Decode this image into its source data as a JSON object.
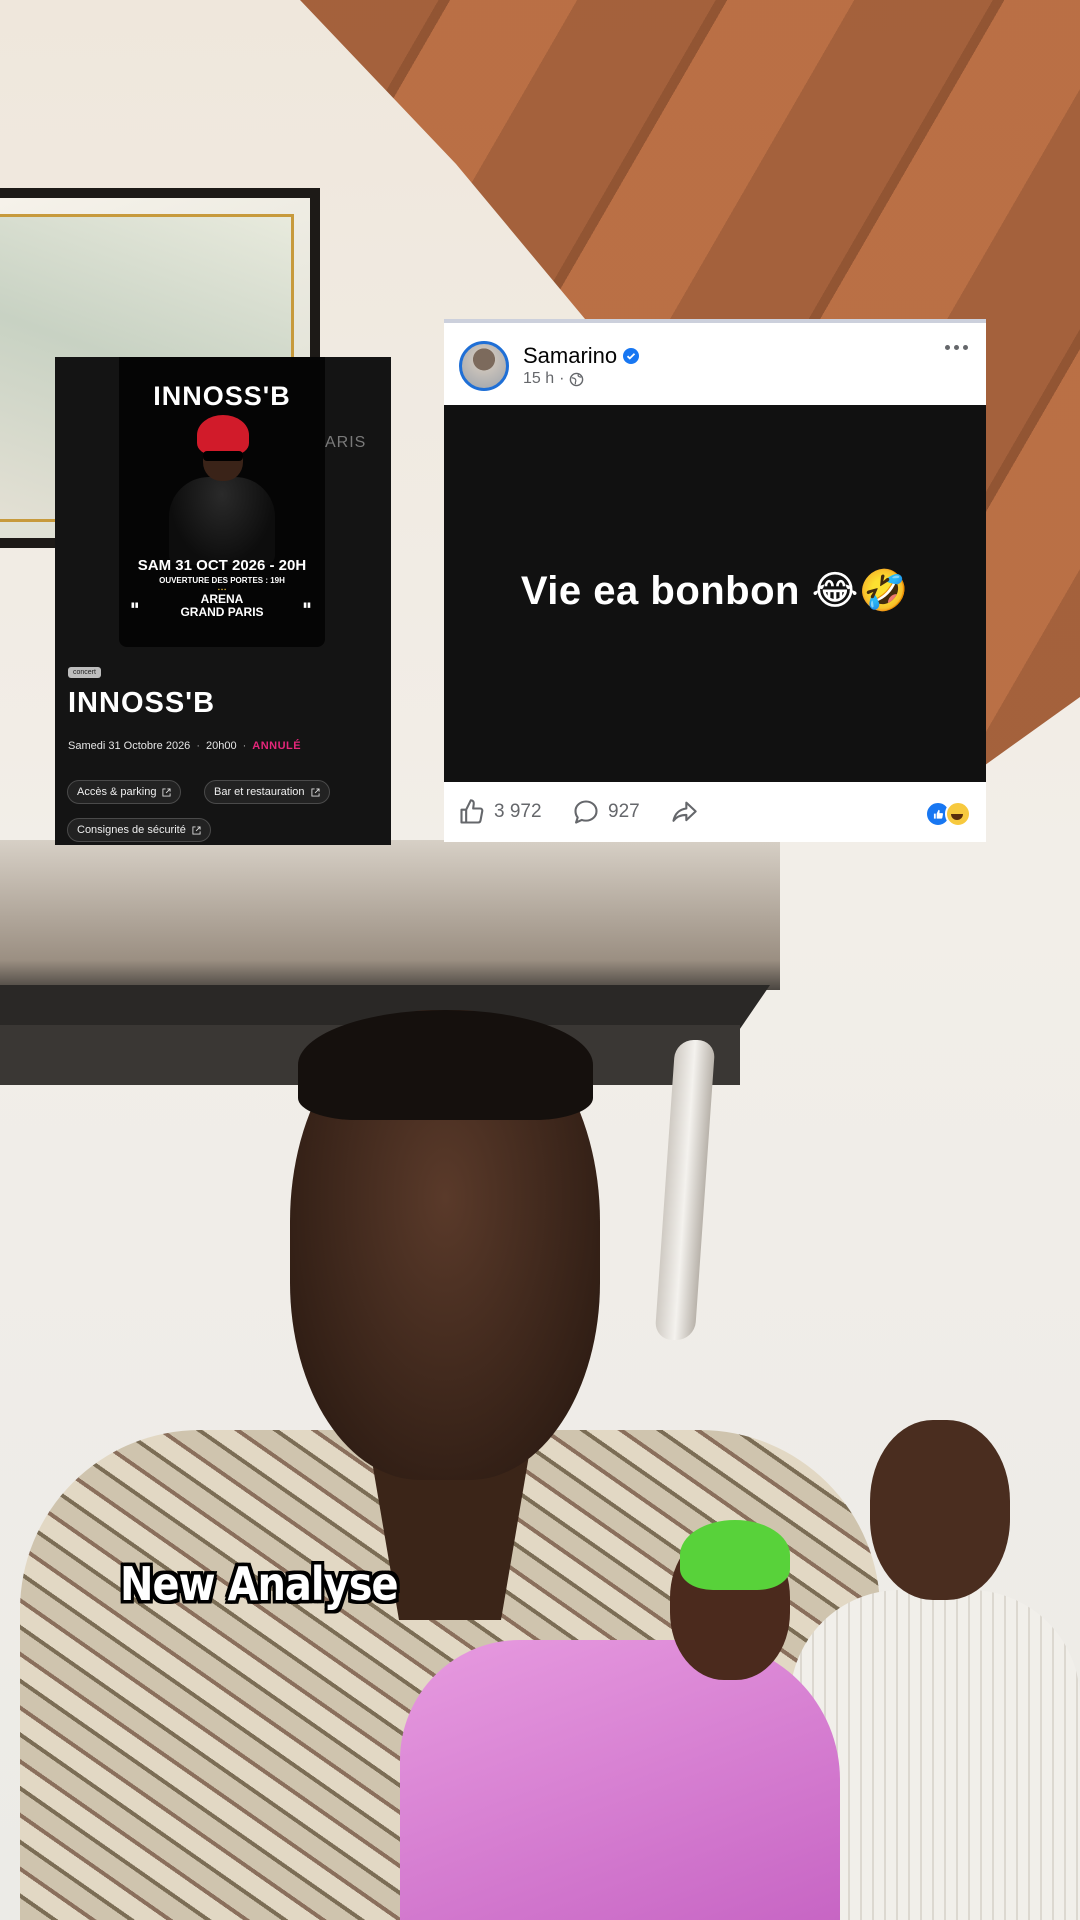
{
  "caption": "New Analyse",
  "event_card": {
    "poster": {
      "title": "INNOSS'B",
      "date": "SAM 31 OCT 2026 - 20H",
      "doors": "OUVERTURE DES PORTES : 19H",
      "venue_line1": "ARENA",
      "venue_line2": "GRAND PARIS",
      "ghost_text": "ARIS"
    },
    "badge": "concert",
    "title": "INNOSS'B",
    "date": "Samedi 31 Octobre 2026",
    "time": "20h00",
    "status": "ANNULÉ",
    "status_color": "#e5267a",
    "links": [
      {
        "label": "Accès & parking",
        "icon": "external-link-icon"
      },
      {
        "label": "Bar et restauration",
        "icon": "external-link-icon"
      },
      {
        "label": "Consignes de sécurité",
        "icon": "external-link-icon"
      }
    ]
  },
  "post": {
    "author": "Samarino",
    "time": "15 h",
    "text": "Vie ea bonbon 😂🤣",
    "likes": "3 972",
    "comments": "927",
    "accent": "#1877f2"
  }
}
